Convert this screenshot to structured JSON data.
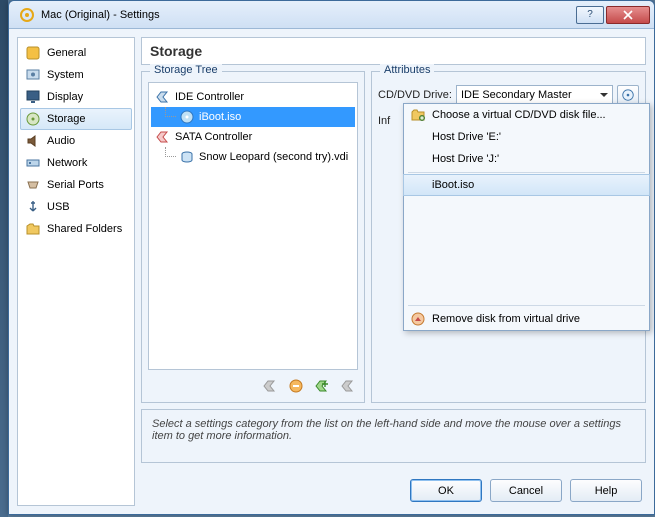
{
  "window": {
    "title": "Mac (Original) - Settings"
  },
  "sidebar": {
    "items": [
      {
        "label": "General"
      },
      {
        "label": "System"
      },
      {
        "label": "Display"
      },
      {
        "label": "Storage"
      },
      {
        "label": "Audio"
      },
      {
        "label": "Network"
      },
      {
        "label": "Serial Ports"
      },
      {
        "label": "USB"
      },
      {
        "label": "Shared Folders"
      }
    ]
  },
  "page": {
    "title": "Storage",
    "tree_label": "Storage Tree",
    "attrs_label": "Attributes",
    "ide": "IDE Controller",
    "ide_child": "iBoot.iso",
    "sata": "SATA Controller",
    "sata_child": "Snow Leopard (second try).vdi",
    "drive_label": "CD/DVD Drive:",
    "drive_value": "IDE Secondary Master",
    "info_label": "Inf"
  },
  "menu": {
    "choose": "Choose a virtual CD/DVD disk file...",
    "hostE": "Host Drive 'E:'",
    "hostJ": "Host Drive 'J:'",
    "iboot": "iBoot.iso",
    "remove": "Remove disk from virtual drive"
  },
  "hint": "Select a settings category from the list on the left-hand side and move the mouse over a settings item to get more information.",
  "buttons": {
    "ok": "OK",
    "cancel": "Cancel",
    "help": "Help"
  }
}
